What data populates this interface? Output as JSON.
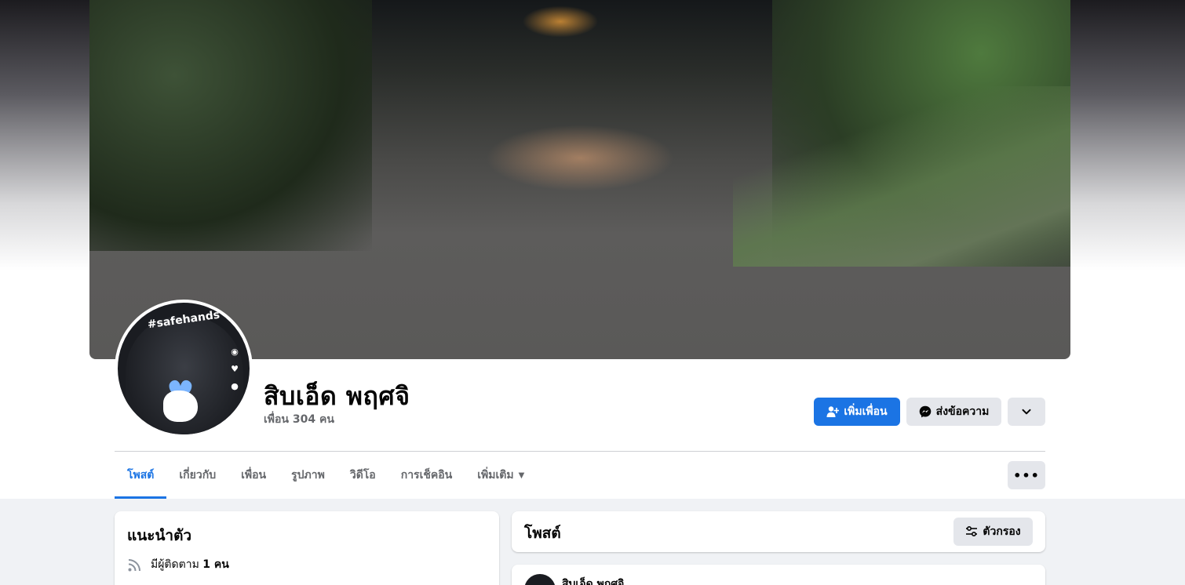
{
  "profile": {
    "name": "สิบเอ็ด พฤศจิ",
    "friends_text": "เพื่อน 304 คน",
    "avatar_tag": "#safehands"
  },
  "actions": {
    "add_friend_label": "เพิ่มเพื่อน",
    "message_label": "ส่งข้อความ",
    "add_friend_icon": "add-person-icon",
    "message_icon": "messenger-icon",
    "more_icon": "chevron-down-icon"
  },
  "tabs": [
    {
      "label": "โพสต์",
      "active": true
    },
    {
      "label": "เกี่ยวกับ"
    },
    {
      "label": "เพื่อน"
    },
    {
      "label": "รูปภาพ"
    },
    {
      "label": "วิดีโอ"
    },
    {
      "label": "การเช็คอิน"
    },
    {
      "label": "เพิ่มเติม",
      "caret": "▼"
    }
  ],
  "tab_more_label": "•••",
  "intro": {
    "title": "แนะนำตัว",
    "followers_prefix": "มีผู้ติดตาม",
    "followers_count": "1 คน",
    "followers_icon": "rss-icon"
  },
  "posts": {
    "title": "โพสต์",
    "filter_label": "ตัวกรอง",
    "filter_icon": "sliders-icon",
    "first_post_author": "สิบเอ็ด พฤศจิ"
  },
  "colors": {
    "accent": "#1b74e4",
    "button_gray": "#e4e6eb",
    "background": "#f0f2f5"
  }
}
